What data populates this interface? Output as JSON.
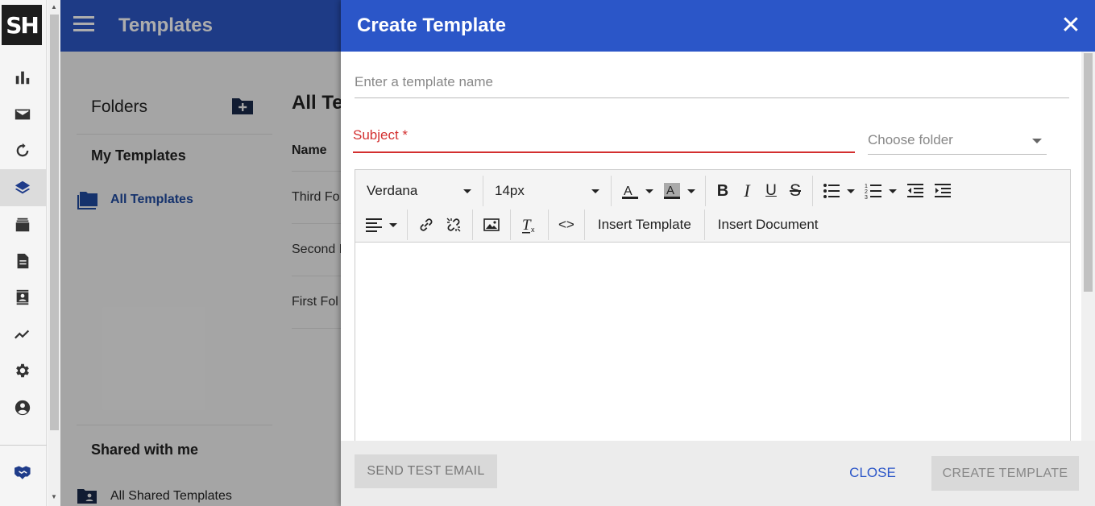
{
  "app": {
    "logo_text": "SH",
    "page_title": "Templates"
  },
  "rail": {
    "icons": [
      "bar-chart-icon",
      "mail-icon",
      "sync-icon",
      "layers-icon",
      "inbox-icon",
      "document-icon",
      "contacts-icon",
      "trend-icon",
      "gear-icon",
      "account-icon",
      "handshake-icon"
    ],
    "active": "layers-icon"
  },
  "folders": {
    "title": "Folders",
    "my_templates": "My Templates",
    "all_templates": "All Templates",
    "shared_with_me": "Shared with me",
    "all_shared_templates": "All Shared Templates"
  },
  "list": {
    "title": "All Te",
    "column_name": "Name",
    "rows": [
      "Third Fo",
      "Second F",
      "First Fol"
    ]
  },
  "dialog": {
    "title": "Create Template",
    "name_placeholder": "Enter a template name",
    "subject_label": "Subject *",
    "folder_placeholder": "Choose folder",
    "toolbar": {
      "font_family": "Verdana",
      "font_size": "14px",
      "insert_template": "Insert Template",
      "insert_document": "Insert Document"
    },
    "buttons": {
      "send_test": "SEND TEST EMAIL",
      "close": "CLOSE",
      "create": "CREATE TEMPLATE"
    }
  },
  "colors": {
    "primary": "#2b56c8",
    "error": "#d32f2f",
    "header_bg": "#2d58c6"
  }
}
